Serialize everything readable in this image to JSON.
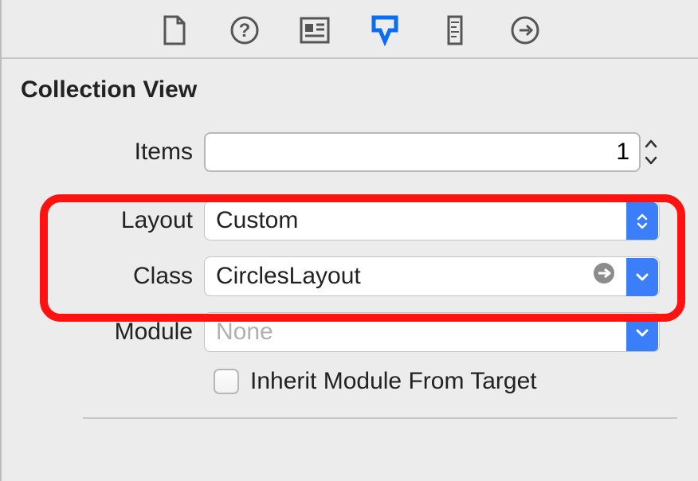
{
  "section": {
    "title": "Collection View"
  },
  "fields": {
    "items_label": "Items",
    "items_value": "1",
    "layout_label": "Layout",
    "layout_value": "Custom",
    "class_label": "Class",
    "class_value": "CirclesLayout",
    "module_label": "Module",
    "module_placeholder": "None",
    "inherit_label": "Inherit Module From Target"
  }
}
